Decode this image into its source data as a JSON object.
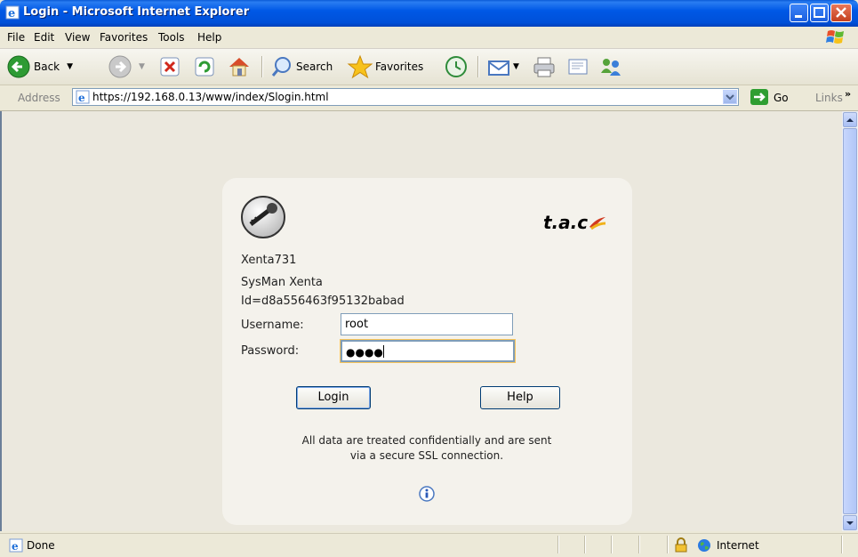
{
  "window": {
    "title": "Login - Microsoft Internet Explorer"
  },
  "menu": {
    "items": [
      "File",
      "Edit",
      "View",
      "Favorites",
      "Tools",
      "Help"
    ]
  },
  "toolbar": {
    "back": "Back",
    "search": "Search",
    "favorites": "Favorites"
  },
  "address": {
    "label": "Address",
    "url": "https://192.168.0.13/www/index/Slogin.html",
    "go": "Go",
    "links": "Links"
  },
  "login": {
    "brand": "t.a.c",
    "device": "Xenta731",
    "product": "SysMan Xenta",
    "id": "Id=d8a556463f95132babad",
    "username_label": "Username:",
    "username_value": "root",
    "password_label": "Password:",
    "password_mask": "●●●●",
    "login_button": "Login",
    "help_button": "Help",
    "notice_line1": "All data are treated confidentially and are sent",
    "notice_line2": "via a secure SSL connection."
  },
  "status": {
    "text": "Done",
    "zone": "Internet"
  }
}
